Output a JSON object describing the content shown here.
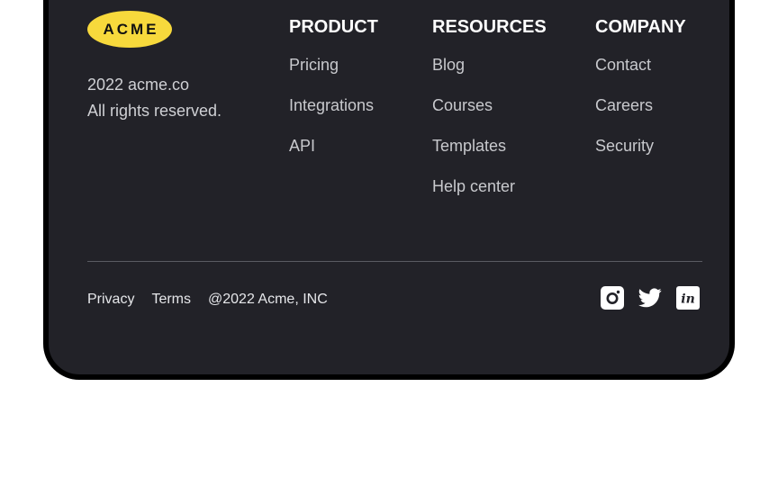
{
  "brand": {
    "logo_text": "ACME",
    "line1": "2022 acme.co",
    "line2": "All rights reserved."
  },
  "columns": [
    {
      "title": "PRODUCT",
      "links": [
        "Pricing",
        "Integrations",
        "API"
      ]
    },
    {
      "title": "RESOURCES",
      "links": [
        "Blog",
        "Courses",
        "Templates",
        "Help center"
      ]
    },
    {
      "title": "COMPANY",
      "links": [
        "Contact",
        "Careers",
        "Security"
      ]
    }
  ],
  "bottom": {
    "privacy": "Privacy",
    "terms": "Terms",
    "copyright": "@2022 Acme, INC"
  },
  "social_icons": [
    "instagram-icon",
    "twitter-icon",
    "linkedin-icon"
  ],
  "colors": {
    "background": "#222228",
    "logo": "#f7d93c",
    "border": "#000000"
  }
}
